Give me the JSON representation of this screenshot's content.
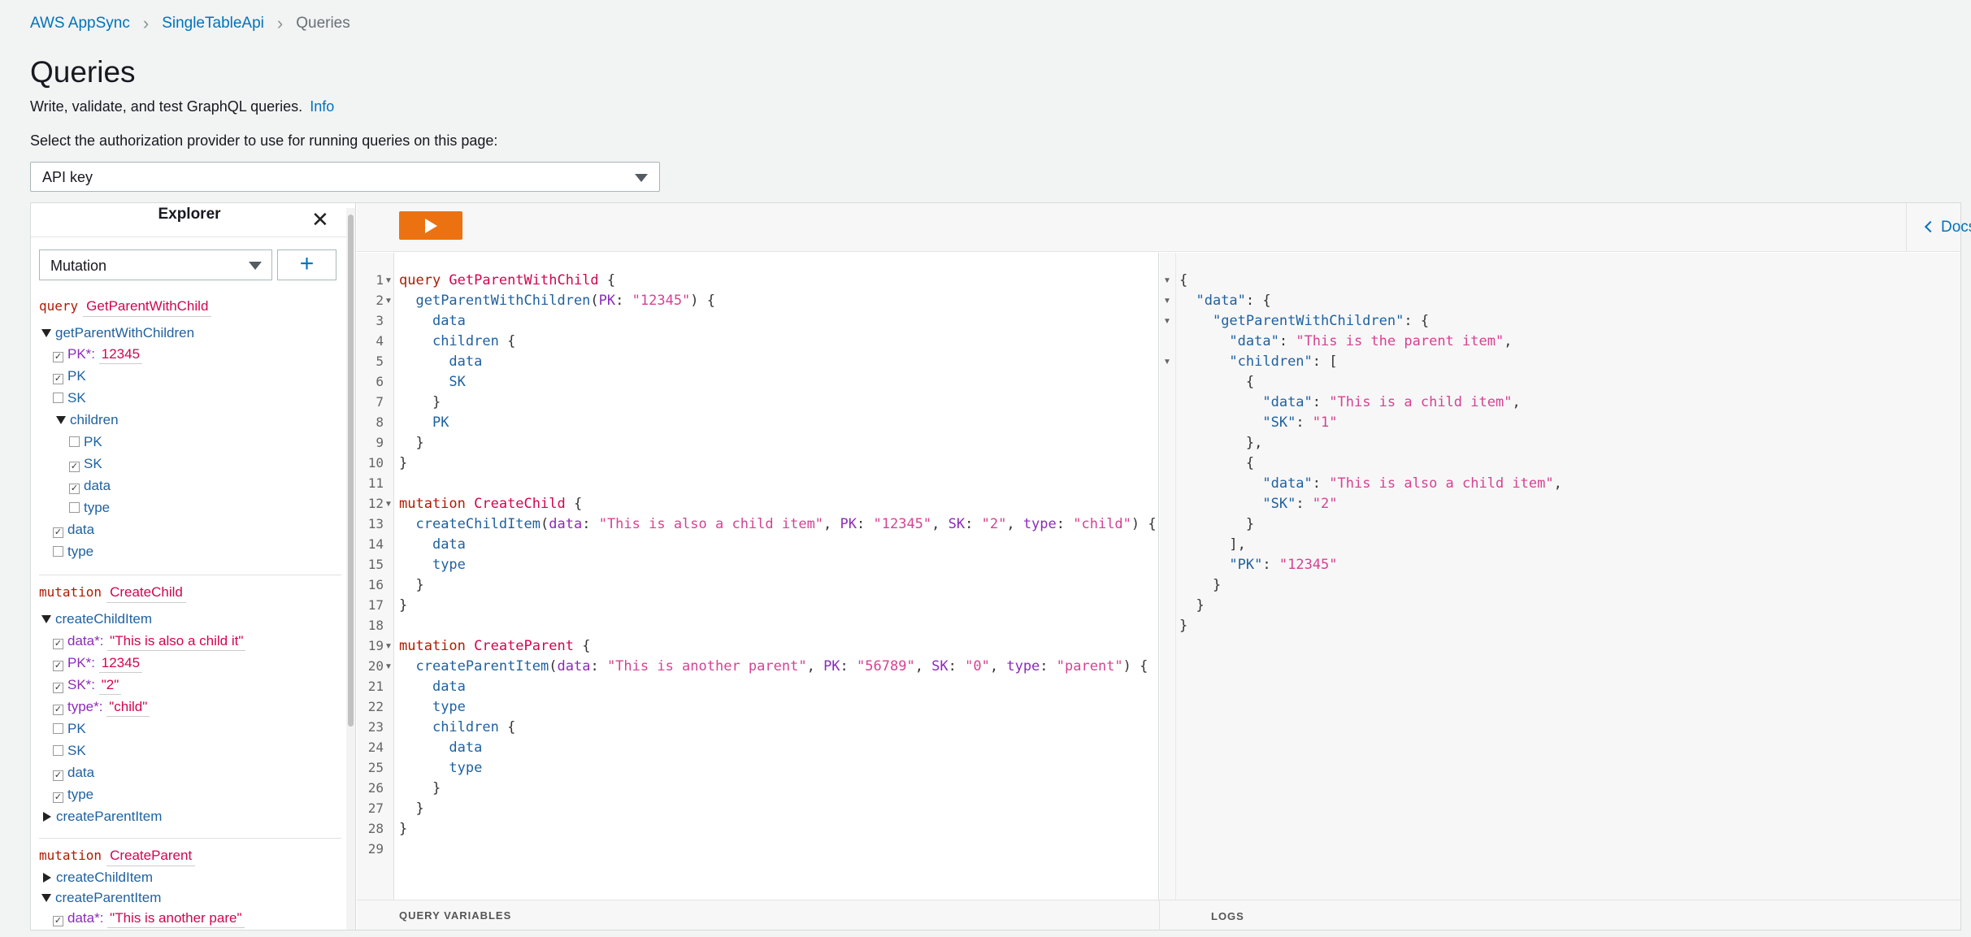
{
  "breadcrumb": {
    "item1": "AWS AppSync",
    "item2": "SingleTableApi",
    "current": "Queries"
  },
  "page": {
    "title": "Queries",
    "description": "Write, validate, and test GraphQL queries.",
    "info_link": "Info",
    "auth_label": "Select the authorization provider to use for running queries on this page:",
    "auth_value": "API key"
  },
  "explorer": {
    "title": "Explorer",
    "operation_type": "Mutation",
    "add_label": "+",
    "op1": {
      "keyword": "query",
      "name": "GetParentWithChild",
      "root_field": "getParentWithChildren",
      "pk_arg": "PK*:",
      "pk_value": "12345",
      "f_pk": "PK",
      "f_sk": "SK",
      "children": "children",
      "c_pk": "PK",
      "c_sk": "SK",
      "c_data": "data",
      "c_type": "type",
      "f_data": "data",
      "f_type": "type"
    },
    "op2": {
      "keyword": "mutation",
      "name": "CreateChild",
      "root_field": "createChildItem",
      "data_arg": "data*:",
      "data_value": "\"This is also a child it\"",
      "pk_arg": "PK*:",
      "pk_value": "12345",
      "sk_arg": "SK*:",
      "sk_value": "\"2\"",
      "type_arg": "type*:",
      "type_value": "\"child\"",
      "f_pk": "PK",
      "f_sk": "SK",
      "f_data": "data",
      "f_type": "type",
      "collapsed": "createParentItem"
    },
    "op3": {
      "keyword": "mutation",
      "name": "CreateParent",
      "collapsed": "createChildItem",
      "root_field": "createParentItem",
      "data_arg": "data*:",
      "data_value": "\"This is another pare\""
    }
  },
  "toolbar": {
    "docs_label": "Docs"
  },
  "editor": {
    "lines": [
      "1",
      "2",
      "3",
      "4",
      "5",
      "6",
      "7",
      "8",
      "9",
      "10",
      "11",
      "12",
      "13",
      "14",
      "15",
      "16",
      "17",
      "18",
      "19",
      "20",
      "21",
      "22",
      "23",
      "24",
      "25",
      "26",
      "27",
      "28",
      "29"
    ]
  },
  "bottom": {
    "query_variables": "QUERY VARIABLES",
    "logs": "LOGS"
  },
  "colors": {
    "run_button": "#ec7211",
    "link": "#0073bb"
  }
}
